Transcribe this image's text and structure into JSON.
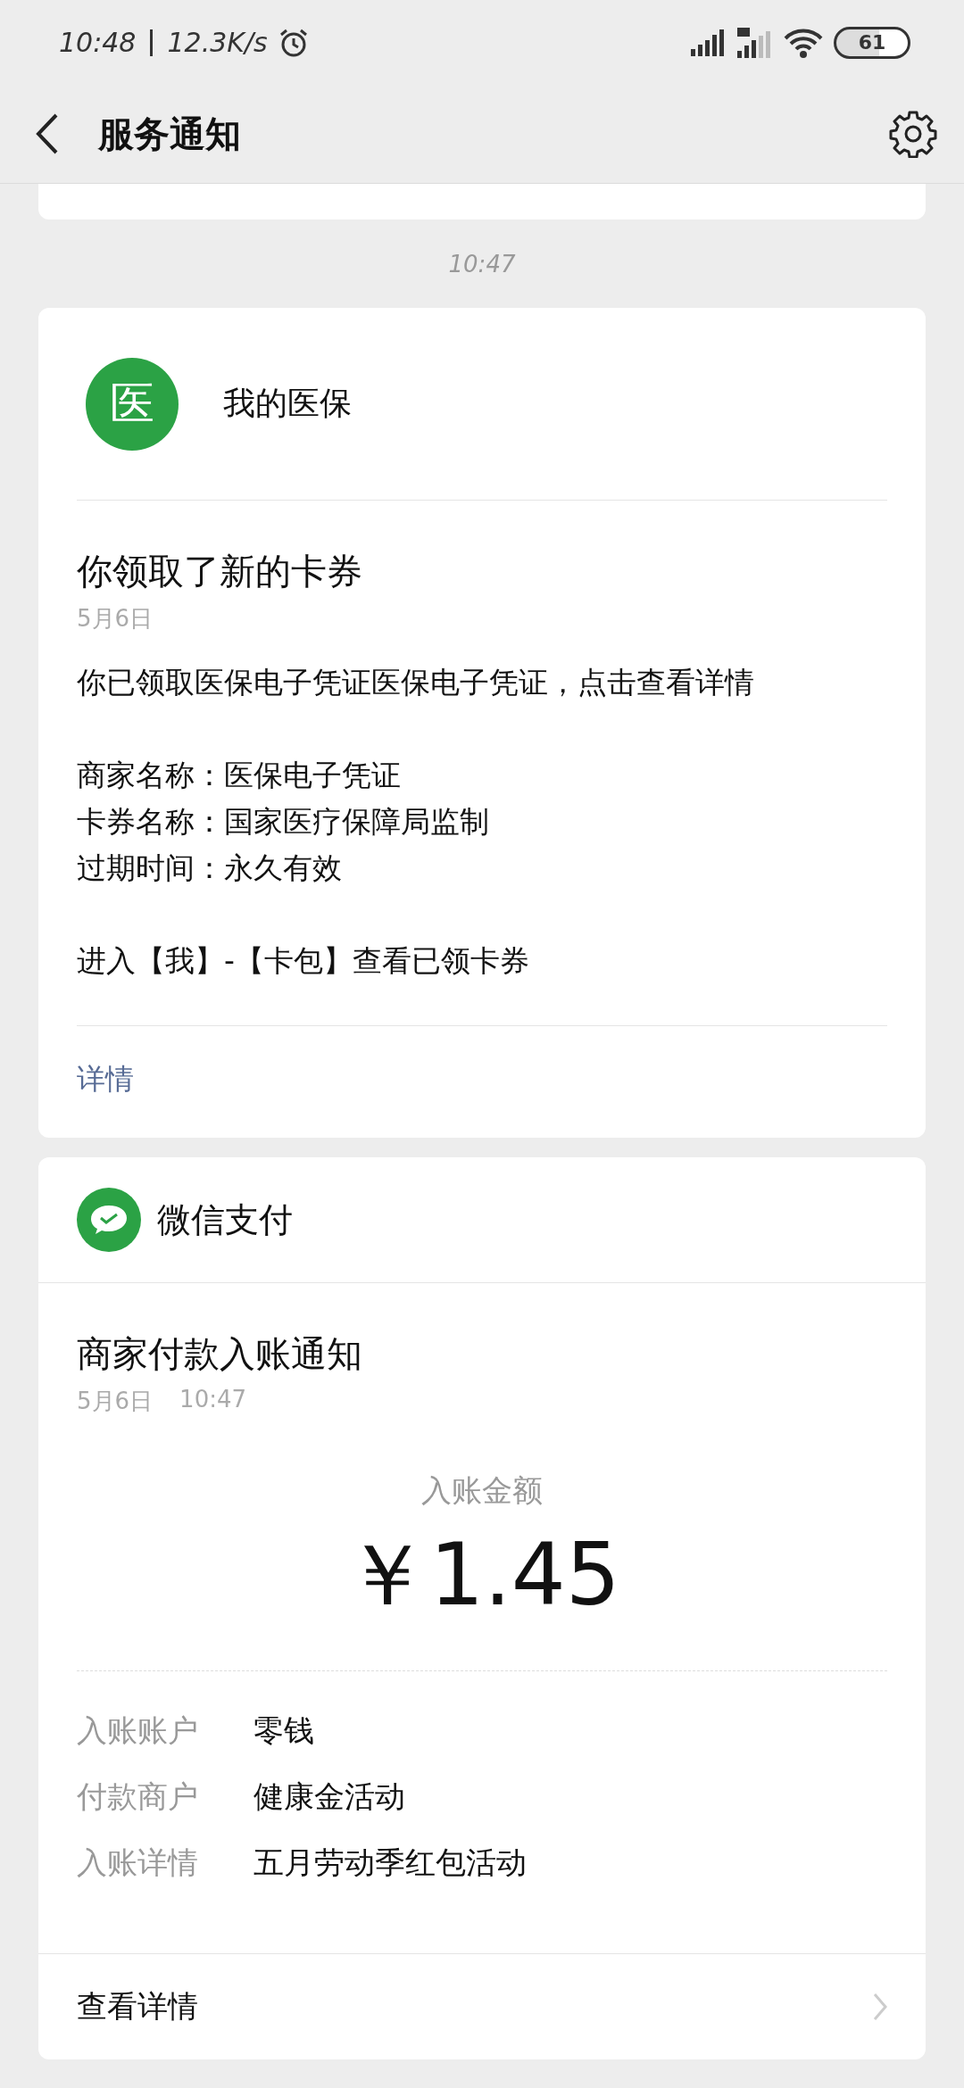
{
  "status_bar": {
    "time": "10:48",
    "speed": "12.3K/s",
    "battery": "61"
  },
  "header": {
    "title": "服务通知"
  },
  "messages": [
    {
      "kind": "notice",
      "time": "10:47",
      "account": "我的医保",
      "avatar_text": "医",
      "title": "你领取了新的卡券",
      "date": "5月6日",
      "paragraphs": [
        [
          "你已领取医保电子凭证医保电子凭证，点击查看详情"
        ],
        [
          "商家名称：医保电子凭证",
          "卡券名称：国家医疗保障局监制",
          "过期时间：永久有效"
        ],
        [
          "进入【我】-【卡包】查看已领卡券"
        ]
      ],
      "link": "详情"
    },
    {
      "kind": "payment",
      "account": "微信支付",
      "title": "商家付款入账通知",
      "date": "5月6日",
      "time": "10:47",
      "amount_label": "入账金额",
      "amount": "￥1.45",
      "fields": [
        {
          "label": "入账账户",
          "value": "零钱"
        },
        {
          "label": "付款商户",
          "value": "健康金活动"
        },
        {
          "label": "入账详情",
          "value": "五月劳动季红包活动"
        }
      ],
      "link": "查看详情"
    }
  ]
}
